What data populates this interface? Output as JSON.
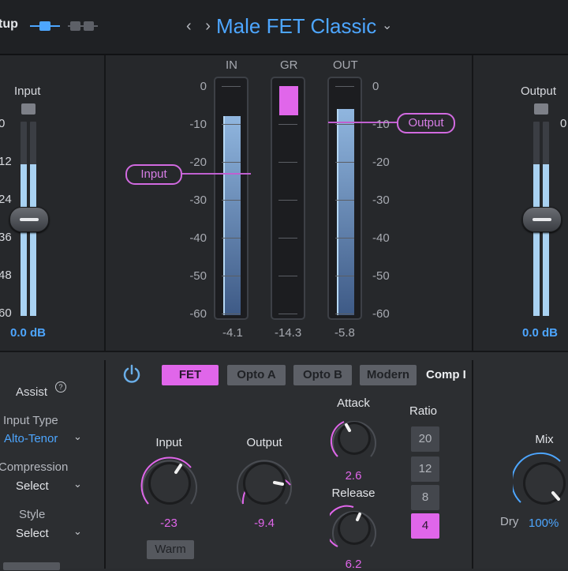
{
  "topbar": {
    "setup_label": "tup",
    "nav_arrows": "‹ ›",
    "preset_name": "Male FET Classic",
    "preset_chevron": "⌄",
    "toggle_icon": "link-toggle-icon",
    "split_icon": "split-view-icon"
  },
  "input_meter": {
    "title": "Input",
    "scale": [
      "0",
      "12",
      "24",
      "36",
      "48",
      "60"
    ],
    "readout": "0.0 dB",
    "level": 0.78
  },
  "output_meter": {
    "title": "Output",
    "scale": [
      "0",
      "",
      "",
      "",
      "",
      ""
    ],
    "readout": "0.0 dB",
    "level": 0.78
  },
  "meters": {
    "columns": [
      "IN",
      "GR",
      "OUT"
    ],
    "scale_left": [
      "0",
      "-10",
      "-20",
      "-30",
      "-40",
      "-50",
      "-60"
    ],
    "scale_right": [
      "0",
      "-10",
      "-20",
      "-30",
      "-40",
      "-50",
      "-60"
    ],
    "in_value": "-4.1",
    "gr_value": "-14.3",
    "out_value": "-5.8",
    "in_level_db": -9,
    "gr_level_db": -8,
    "out_level_db": -7,
    "callout_input": "Input",
    "callout_output": "Output"
  },
  "left_panel": {
    "assist_label": "Assist",
    "assist_help": "?",
    "input_type_label": "Input Type",
    "input_type_value": "Alto-Tenor",
    "compression_label": "Compression",
    "compression_value": "Select",
    "style_label": "Style",
    "style_value": "Select",
    "chevron": "⌄"
  },
  "comp": {
    "power_icon": "power-icon",
    "types": [
      "FET",
      "Opto A",
      "Opto B",
      "Modern"
    ],
    "active_type": "FET",
    "comp_label": "Comp I",
    "input_label": "Input",
    "input_value": "-23",
    "output_label": "Output",
    "output_value": "-9.4",
    "attack_label": "Attack",
    "attack_value": "2.6",
    "release_label": "Release",
    "release_value": "6.2",
    "warm_label": "Warm",
    "ratio_label": "Ratio",
    "ratios": [
      "20",
      "12",
      "8",
      "4"
    ],
    "active_ratio": "4"
  },
  "mix": {
    "label": "Mix",
    "dry_label": "Dry",
    "value": "100%"
  },
  "colors": {
    "accent_pink": "#e066ea",
    "accent_blue": "#4da6ff",
    "meter_blue": "#a9d2f2"
  }
}
